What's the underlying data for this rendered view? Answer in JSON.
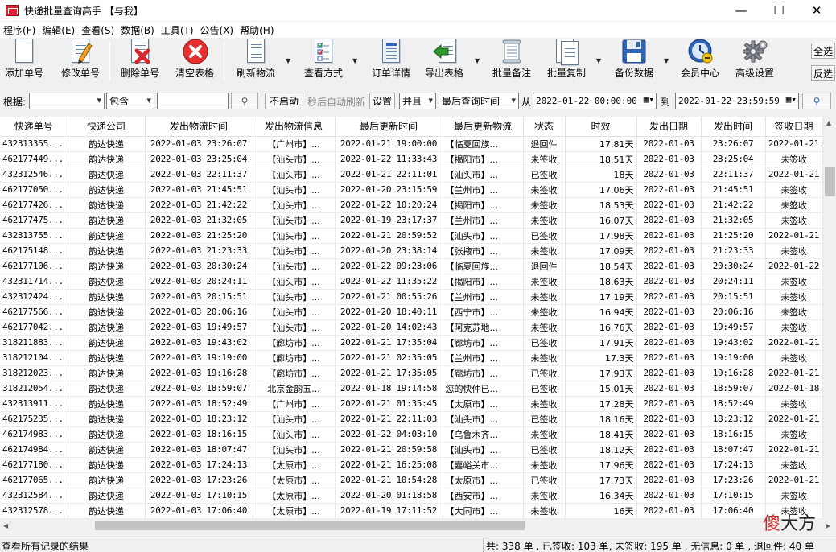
{
  "window": {
    "title": "快递批量查询高手 【与我】",
    "minimize": "—",
    "maximize": "☐",
    "close": "✕"
  },
  "menu": [
    "程序(F)",
    "编辑(E)",
    "查看(S)",
    "数据(B)",
    "工具(T)",
    "公告(X)",
    "帮助(H)"
  ],
  "toolbar": {
    "add": "添加单号",
    "edit": "修改单号",
    "delete": "删除单号",
    "clear": "清空表格",
    "refresh": "刷新物流",
    "view_mode": "查看方式",
    "order_detail": "订单详情",
    "export": "导出表格",
    "batch_note": "批量备注",
    "batch_copy": "批量复制",
    "backup": "备份数据",
    "member": "会员中心",
    "settings": "高级设置",
    "select_all": "全选",
    "invert": "反选"
  },
  "filter": {
    "by_label": "根据:",
    "field_value": "",
    "op_value": "包含",
    "keyword": "",
    "auto_btn": "不启动",
    "auto_hint": "秒后自动刷新",
    "set_btn": "设置",
    "logic": "并且",
    "time_field": "最后查询时间",
    "from_label": "从",
    "from_value": "2022-01-22 00:00:00",
    "to_label": "到",
    "to_value": "2022-01-22 23:59:59"
  },
  "table": {
    "headers": [
      "快递单号",
      "快递公司",
      "发出物流时间",
      "发出物流信息",
      "最后更新时间",
      "最后更新物流",
      "状态",
      "时效",
      "发出日期",
      "发出时间",
      "签收日期"
    ],
    "rows": [
      [
        "432313355...",
        "韵达快递",
        "2022-01-03 23:26:07",
        "【广州市】...",
        "2022-01-21 19:00:00",
        "【临夏回族...",
        "退回件",
        "17.81天",
        "2022-01-03",
        "23:26:07",
        "2022-01-21"
      ],
      [
        "462177449...",
        "韵达快递",
        "2022-01-03 23:25:04",
        "【汕头市】...",
        "2022-01-22 11:33:43",
        "【揭阳市】...",
        "未签收",
        "18.51天",
        "2022-01-03",
        "23:25:04",
        "未签收"
      ],
      [
        "432312546...",
        "韵达快递",
        "2022-01-03 22:11:37",
        "【汕头市】...",
        "2022-01-21 22:11:01",
        "【汕头市】...",
        "已签收",
        "18天",
        "2022-01-03",
        "22:11:37",
        "2022-01-21"
      ],
      [
        "462177050...",
        "韵达快递",
        "2022-01-03 21:45:51",
        "【汕头市】...",
        "2022-01-20 23:15:59",
        "【兰州市】...",
        "未签收",
        "17.06天",
        "2022-01-03",
        "21:45:51",
        "未签收"
      ],
      [
        "462177426...",
        "韵达快递",
        "2022-01-03 21:42:22",
        "【汕头市】...",
        "2022-01-22 10:20:24",
        "【揭阳市】...",
        "未签收",
        "18.53天",
        "2022-01-03",
        "21:42:22",
        "未签收"
      ],
      [
        "462177475...",
        "韵达快递",
        "2022-01-03 21:32:05",
        "【汕头市】...",
        "2022-01-19 23:17:37",
        "【兰州市】...",
        "未签收",
        "16.07天",
        "2022-01-03",
        "21:32:05",
        "未签收"
      ],
      [
        "432313755...",
        "韵达快递",
        "2022-01-03 21:25:20",
        "【汕头市】...",
        "2022-01-21 20:59:52",
        "【汕头市】...",
        "已签收",
        "17.98天",
        "2022-01-03",
        "21:25:20",
        "2022-01-21"
      ],
      [
        "462175148...",
        "韵达快递",
        "2022-01-03 21:23:33",
        "【汕头市】...",
        "2022-01-20 23:38:14",
        "【张掖市】...",
        "未签收",
        "17.09天",
        "2022-01-03",
        "21:23:33",
        "未签收"
      ],
      [
        "462177106...",
        "韵达快递",
        "2022-01-03 20:30:24",
        "【汕头市】...",
        "2022-01-22 09:23:06",
        "【临夏回族...",
        "退回件",
        "18.54天",
        "2022-01-03",
        "20:30:24",
        "2022-01-22"
      ],
      [
        "432311714...",
        "韵达快递",
        "2022-01-03 20:24:11",
        "【汕头市】...",
        "2022-01-22 11:35:22",
        "【揭阳市】...",
        "未签收",
        "18.63天",
        "2022-01-03",
        "20:24:11",
        "未签收"
      ],
      [
        "432312424...",
        "韵达快递",
        "2022-01-03 20:15:51",
        "【汕头市】...",
        "2022-01-21 00:55:26",
        "【兰州市】...",
        "未签收",
        "17.19天",
        "2022-01-03",
        "20:15:51",
        "未签收"
      ],
      [
        "462177566...",
        "韵达快递",
        "2022-01-03 20:06:16",
        "【汕头市】...",
        "2022-01-20 18:40:11",
        "【西宁市】...",
        "未签收",
        "16.94天",
        "2022-01-03",
        "20:06:16",
        "未签收"
      ],
      [
        "462177042...",
        "韵达快递",
        "2022-01-03 19:49:57",
        "【汕头市】...",
        "2022-01-20 14:02:43",
        "【阿克苏地...",
        "未签收",
        "16.76天",
        "2022-01-03",
        "19:49:57",
        "未签收"
      ],
      [
        "318211883...",
        "韵达快递",
        "2022-01-03 19:43:02",
        "【廊坊市】...",
        "2022-01-21 17:35:04",
        "【廊坊市】...",
        "已签收",
        "17.91天",
        "2022-01-03",
        "19:43:02",
        "2022-01-21"
      ],
      [
        "318212104...",
        "韵达快递",
        "2022-01-03 19:19:00",
        "【廊坊市】...",
        "2022-01-21 02:35:05",
        "【兰州市】...",
        "未签收",
        "17.3天",
        "2022-01-03",
        "19:19:00",
        "未签收"
      ],
      [
        "318212023...",
        "韵达快递",
        "2022-01-03 19:16:28",
        "【廊坊市】...",
        "2022-01-21 17:35:05",
        "【廊坊市】...",
        "已签收",
        "17.93天",
        "2022-01-03",
        "19:16:28",
        "2022-01-21"
      ],
      [
        "318212054...",
        "韵达快递",
        "2022-01-03 18:59:07",
        "北京金韵五...",
        "2022-01-18 19:14:58",
        "您的快件已...",
        "已签收",
        "15.01天",
        "2022-01-03",
        "18:59:07",
        "2022-01-18"
      ],
      [
        "432313911...",
        "韵达快递",
        "2022-01-03 18:52:49",
        "【广州市】...",
        "2022-01-21 01:35:45",
        "【太原市】...",
        "未签收",
        "17.28天",
        "2022-01-03",
        "18:52:49",
        "未签收"
      ],
      [
        "462175235...",
        "韵达快递",
        "2022-01-03 18:23:12",
        "【汕头市】...",
        "2022-01-21 22:11:03",
        "【汕头市】...",
        "已签收",
        "18.16天",
        "2022-01-03",
        "18:23:12",
        "2022-01-21"
      ],
      [
        "462174983...",
        "韵达快递",
        "2022-01-03 18:16:15",
        "【汕头市】...",
        "2022-01-22 04:03:10",
        "【乌鲁木齐...",
        "未签收",
        "18.41天",
        "2022-01-03",
        "18:16:15",
        "未签收"
      ],
      [
        "462174984...",
        "韵达快递",
        "2022-01-03 18:07:47",
        "【汕头市】...",
        "2022-01-21 20:59:58",
        "【汕头市】...",
        "已签收",
        "18.12天",
        "2022-01-03",
        "18:07:47",
        "2022-01-21"
      ],
      [
        "462177180...",
        "韵达快递",
        "2022-01-03 17:24:13",
        "【太原市】...",
        "2022-01-21 16:25:08",
        "【嘉峪关市...",
        "未签收",
        "17.96天",
        "2022-01-03",
        "17:24:13",
        "未签收"
      ],
      [
        "462177065...",
        "韵达快递",
        "2022-01-03 17:23:26",
        "【太原市】...",
        "2022-01-21 10:54:28",
        "【太原市】...",
        "已签收",
        "17.73天",
        "2022-01-03",
        "17:23:26",
        "2022-01-21"
      ],
      [
        "432312584...",
        "韵达快递",
        "2022-01-03 17:10:15",
        "【太原市】...",
        "2022-01-20 01:18:58",
        "【西安市】...",
        "未签收",
        "16.34天",
        "2022-01-03",
        "17:10:15",
        "未签收"
      ],
      [
        "432312578...",
        "韵达快递",
        "2022-01-03 17:06:40",
        "【太原市】...",
        "2022-01-19 17:11:52",
        "【大同市】...",
        "未签收",
        "16天",
        "2022-01-03",
        "17:06:40",
        "未签收"
      ]
    ]
  },
  "status": {
    "left": "查看所有记录的结果",
    "right": "共: 338 单 , 已签收: 103 单, 未签收: 195 单 , 无信息: 0 单 , 退回件: 40 单"
  },
  "watermark": {
    "red": "傻",
    "black": "大方"
  },
  "colors": {
    "delete_red": "#d9262c",
    "clear_red": "#e53030",
    "export_green": "#2e9a2e",
    "icon_blue": "#2d63b8"
  }
}
